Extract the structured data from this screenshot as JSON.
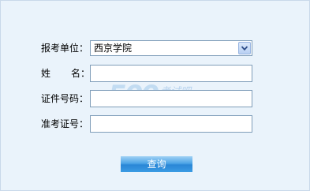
{
  "form": {
    "unit": {
      "label": "报考单位",
      "colon": "：",
      "selected": "西京学院"
    },
    "name": {
      "label_chars": [
        "姓",
        "名"
      ],
      "colon": "：",
      "value": ""
    },
    "id_number": {
      "label": "证件号码",
      "colon": "：",
      "value": ""
    },
    "ticket_number": {
      "label": "准考证号",
      "colon": "：",
      "value": ""
    },
    "query_button": "查询"
  },
  "watermark": {
    "number": "500",
    "text": "考试吧",
    "domain": ".com"
  },
  "colors": {
    "background": "#eaf3fb",
    "field_border": "#7f9db9",
    "button_blue": "#2a86d6"
  }
}
